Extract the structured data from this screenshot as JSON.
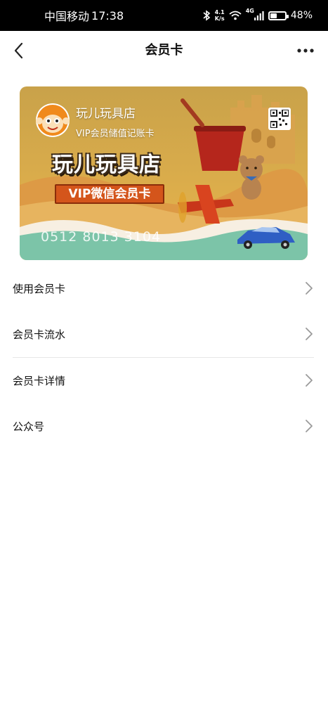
{
  "status_bar": {
    "carrier": "中国移动",
    "time": "17:38",
    "network_speed_value": "4.1",
    "network_speed_unit": "K/s",
    "network_type": "4G",
    "battery_percent": "48%",
    "battery_level": 0.48,
    "icons": [
      "bluetooth-icon",
      "wifi-icon",
      "signal-icon",
      "battery-icon"
    ]
  },
  "nav": {
    "title": "会员卡",
    "back_icon": "chevron-left-icon",
    "more_icon": "more-dots-icon"
  },
  "card": {
    "shop_name": "玩儿玩具店",
    "card_type": "VIP会员储值记账卡",
    "big_title": "玩儿玩具店",
    "banner": "VIP微信会员卡",
    "card_number": "0512 8013 3104",
    "qr_icon": "qr-code-icon",
    "colors": {
      "sky": "#e8b24a",
      "sand": "#d98a3a",
      "sea": "#7cc4a8",
      "banner": "#d4551b"
    }
  },
  "menu": {
    "items": [
      {
        "label": "使用会员卡"
      },
      {
        "label": "会员卡流水"
      },
      {
        "label": "会员卡详情"
      },
      {
        "label": "公众号"
      }
    ]
  }
}
